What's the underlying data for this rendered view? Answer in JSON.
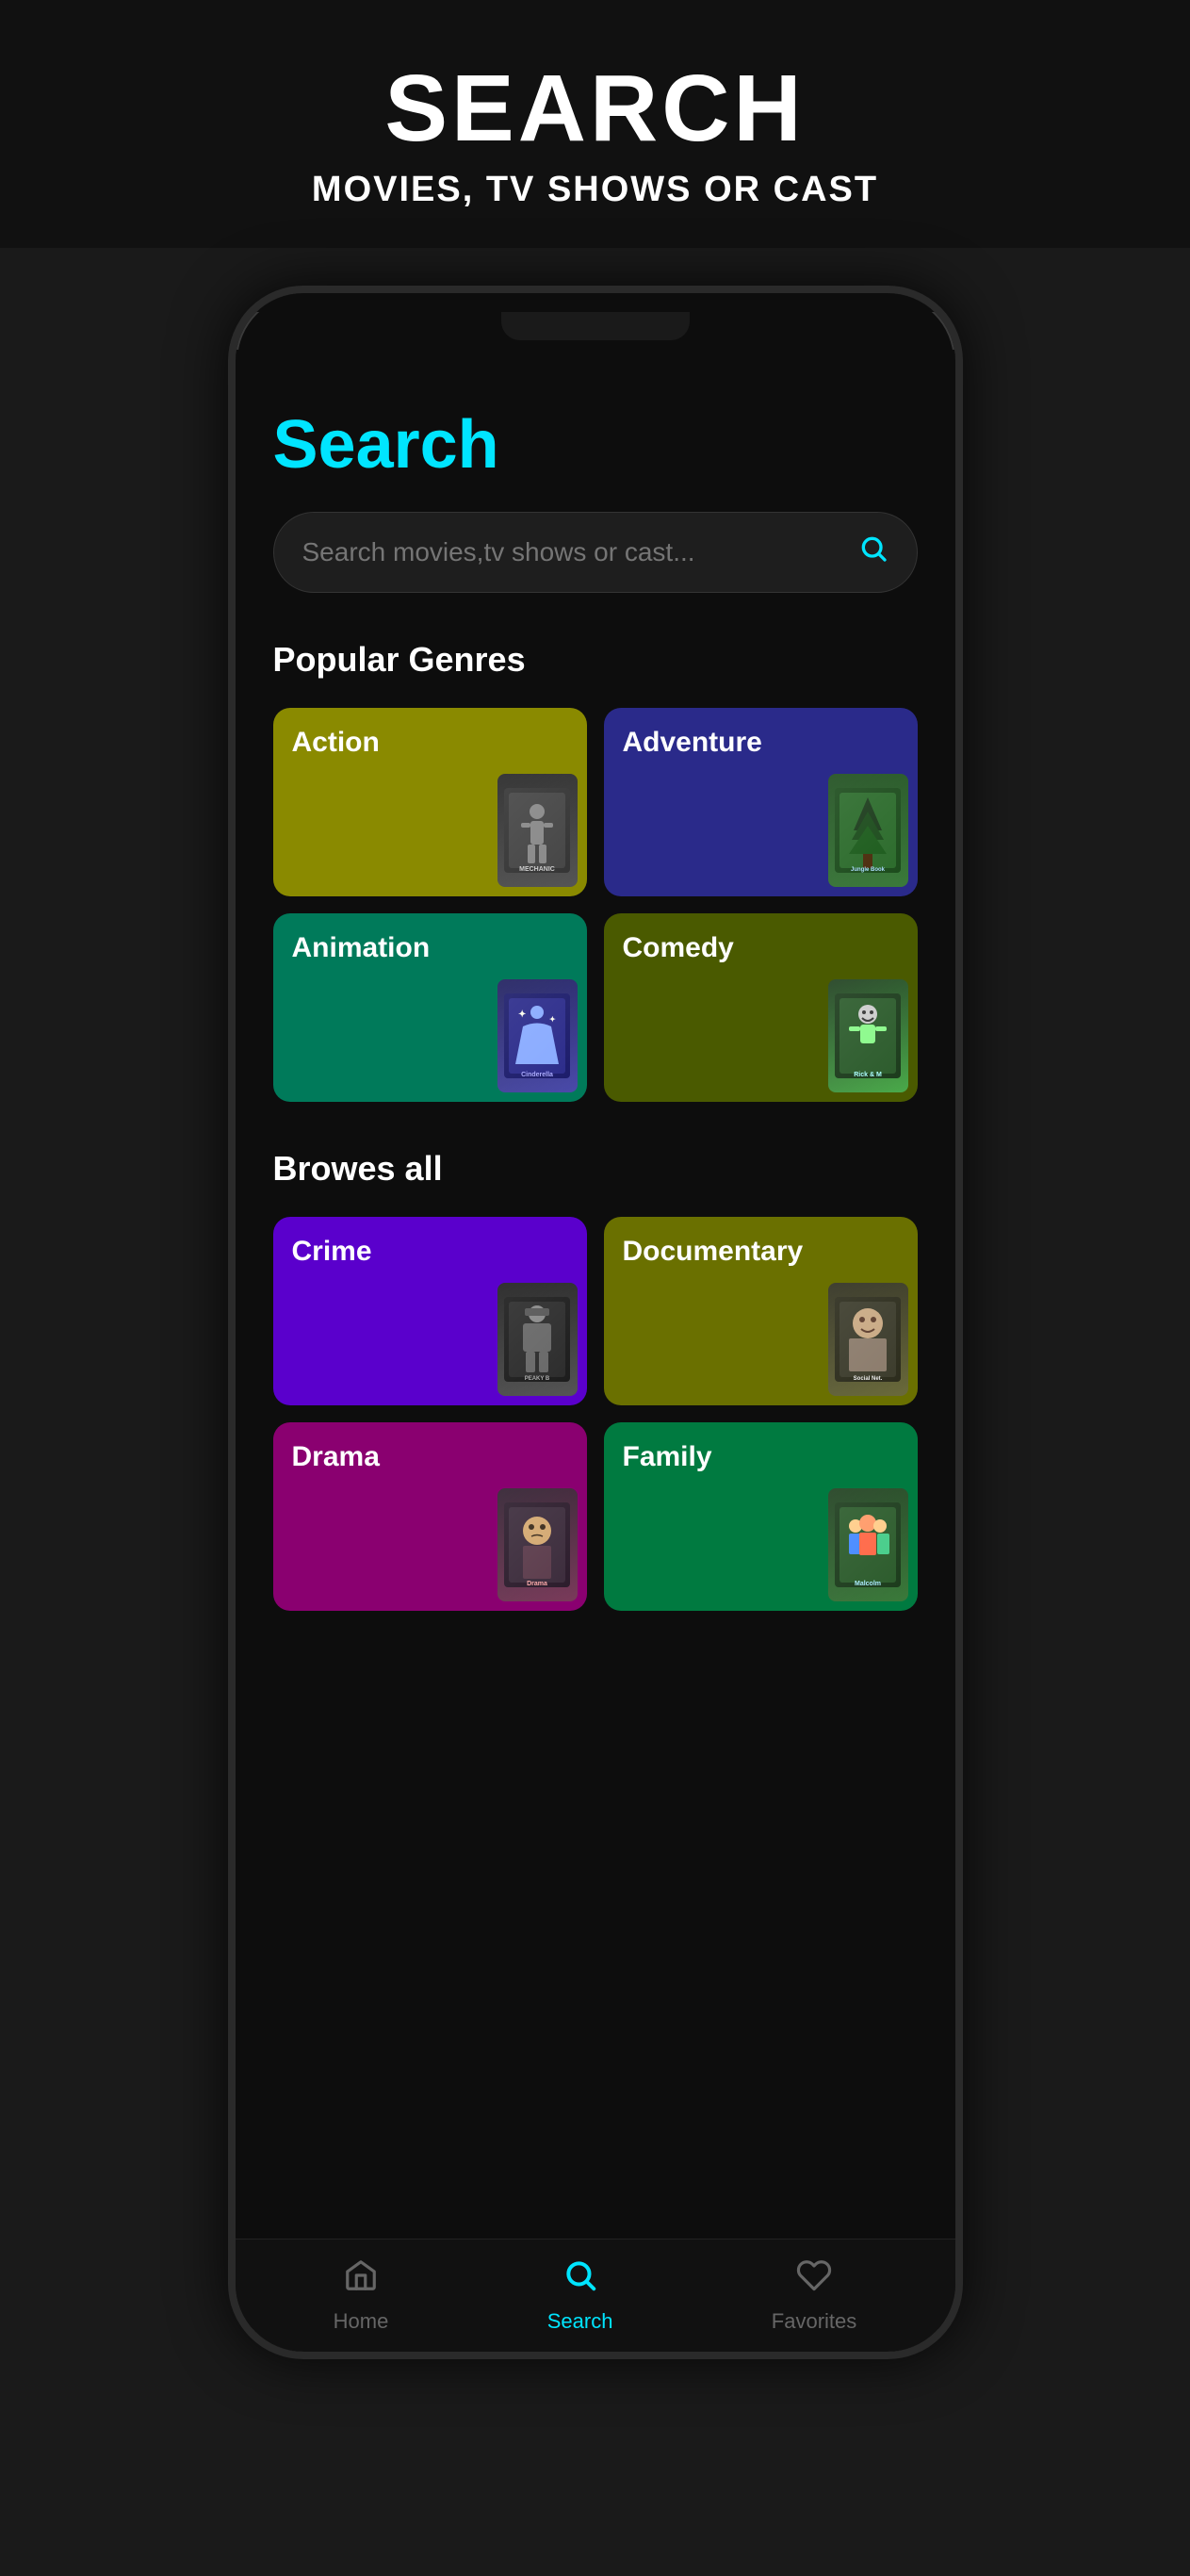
{
  "header": {
    "title": "SEARCH",
    "subtitle": "MOVIES, TV SHOWS OR CAST"
  },
  "screen": {
    "title": "Search",
    "search": {
      "placeholder": "Search movies,tv shows or cast...",
      "icon": "search-icon"
    },
    "sections": [
      {
        "title": "Popular Genres",
        "genres": [
          {
            "name": "Action",
            "color": "#8a8a00",
            "poster": "MECHANIC",
            "posterClass": "poster-mechanic"
          },
          {
            "name": "Adventure",
            "color": "#2a2a8a",
            "poster": "Jungle Book",
            "posterClass": "poster-jungle"
          },
          {
            "name": "Animation",
            "color": "#007a5a",
            "poster": "Cinderella",
            "posterClass": "poster-cinderella"
          },
          {
            "name": "Comedy",
            "color": "#4a5a00",
            "poster": "Rick & M",
            "posterClass": "poster-rick"
          }
        ]
      },
      {
        "title": "Browes all",
        "genres": [
          {
            "name": "Crime",
            "color": "#5a00cc",
            "poster": "Peaky Blinders",
            "posterClass": "poster-peaky"
          },
          {
            "name": "Documentary",
            "color": "#6a7000",
            "poster": "Social Network",
            "posterClass": "poster-social"
          },
          {
            "name": "Drama",
            "color": "#8a0070",
            "poster": "Drama Film",
            "posterClass": "poster-drama-p"
          },
          {
            "name": "Family",
            "color": "#007a40",
            "poster": "Malcolm",
            "posterClass": "poster-malcolm"
          }
        ]
      }
    ]
  },
  "bottomNav": {
    "items": [
      {
        "label": "Home",
        "icon": "⌂",
        "active": false
      },
      {
        "label": "Search",
        "icon": "⌕",
        "active": true
      },
      {
        "label": "Favorites",
        "icon": "♡",
        "active": false
      }
    ]
  }
}
